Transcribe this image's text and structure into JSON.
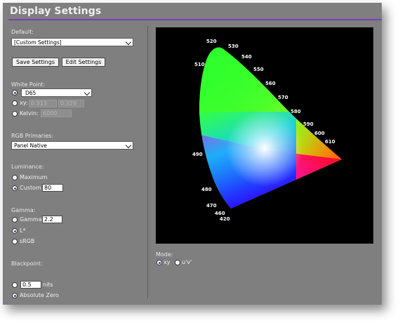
{
  "title": "Display Settings",
  "default": {
    "label": "Default:",
    "selected": "[Custom Settings]",
    "save_button": "Save Settings",
    "edit_button": "Edit Settings"
  },
  "white_point": {
    "label": "White Point:",
    "options": [
      {
        "label": "",
        "checked": true
      },
      {
        "label": "xy:",
        "checked": false
      },
      {
        "label": "Kelvin:",
        "checked": false
      }
    ],
    "selected": "D65",
    "x_value": "0.313",
    "y_value": "0.329",
    "kelvin_value": "6000"
  },
  "rgb_primaries": {
    "label": "RGB Primaries:",
    "selected": "Panel Native"
  },
  "luminance": {
    "label": "Luminance:",
    "options": [
      {
        "label": "Maximum",
        "checked": false
      },
      {
        "label": "Custom",
        "checked": true
      }
    ],
    "custom_value": "80"
  },
  "gamma": {
    "label": "Gamma:",
    "options": [
      {
        "label": "Gamma",
        "checked": false
      },
      {
        "label": "L*",
        "checked": true
      },
      {
        "label": "sRGB",
        "checked": false
      }
    ],
    "gamma_value": "2.2"
  },
  "blackpoint": {
    "label": "Blackpoint:",
    "value": "0.5",
    "unit": "nits",
    "options": [
      {
        "label": "",
        "checked": false
      },
      {
        "label": "Absolute Zero",
        "checked": true
      }
    ]
  },
  "mode": {
    "label": "Mode:",
    "options": [
      {
        "label": "xy",
        "checked": true
      },
      {
        "label": "u'v'",
        "checked": false
      }
    ]
  },
  "chromaticity": {
    "wavelength_labels": [
      "520",
      "530",
      "540",
      "550",
      "560",
      "570",
      "580",
      "590",
      "600",
      "610",
      "510",
      "490",
      "480",
      "470",
      "460",
      "420"
    ]
  },
  "colors": {
    "panel": "#7f7f7f",
    "accent": "#7b3fb5",
    "plot_background": "#000000"
  }
}
